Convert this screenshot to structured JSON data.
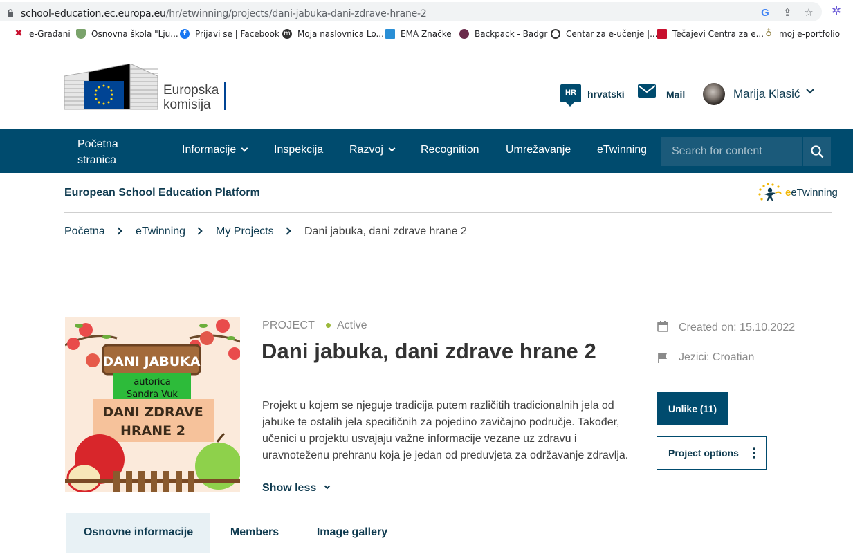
{
  "browser": {
    "url_host": "school-education.ec.europa.eu",
    "url_path": "/hr/etwinning/projects/dani-jabuka-dani-zdrave-hrane-2",
    "bookmarks": [
      {
        "label": "e-Građani"
      },
      {
        "label": "Osnovna škola \"Lju..."
      },
      {
        "label": "Prijavi se | Facebook"
      },
      {
        "label": "Moja naslovnica Lo..."
      },
      {
        "label": "EMA Značke"
      },
      {
        "label": "Backpack - Badgr"
      },
      {
        "label": "Centar za e-učenje |..."
      },
      {
        "label": "Tečajevi Centra za e..."
      },
      {
        "label": "moj e-portfolio"
      }
    ]
  },
  "header": {
    "logo_line1": "Europska",
    "logo_line2": "komisija",
    "lang_code": "HR",
    "lang_label": "hrvatski",
    "mail_label": "Mail",
    "user_name": "Marija Klasić"
  },
  "nav": {
    "items": [
      {
        "label": "Početna stranica"
      },
      {
        "label": "Informacije"
      },
      {
        "label": "Inspekcija"
      },
      {
        "label": "Razvoj"
      },
      {
        "label": "Recognition"
      },
      {
        "label": "Umrežavanje"
      },
      {
        "label": "eTwinning"
      }
    ],
    "search_placeholder": "Search for content"
  },
  "platform": {
    "title": "European School Education Platform",
    "etwinning_logo_text": "eTwinning"
  },
  "breadcrumb": [
    "Početna",
    "eTwinning",
    "My Projects",
    "Dani jabuka, dani zdrave hrane 2"
  ],
  "project": {
    "type": "PROJECT",
    "status": "Active",
    "title": "Dani jabuka, dani zdrave hrane 2",
    "description": "Projekt u kojem se njeguje tradicija putem različitih tradicionalnih jela od jabuke te ostalih jela specifičnih za pojedino zavičajno područje. Također, učenici u projektu usvajaju važne informacije vezane uz zdravu i uravnoteženu prehranu koja je jedan od preduvjeta za održavanje zdravlja.",
    "show_less": "Show less",
    "created_on": "Created on: 15.10.2022",
    "languages": "Jezici: Croatian",
    "unlike_button": "Unlike (11)",
    "options_button": "Project options",
    "image": {
      "line1": "DANI JABUKA",
      "line2": "autorica",
      "line3": "Sandra Vuk",
      "line4": "DANI ZDRAVE",
      "line5": "HRANE 2"
    }
  },
  "tabs": [
    {
      "label": "Osnovne informacije"
    },
    {
      "label": "Members"
    },
    {
      "label": "Image gallery"
    }
  ],
  "colors": {
    "primary": "#004b6e",
    "status_active": "#9bb83b"
  }
}
